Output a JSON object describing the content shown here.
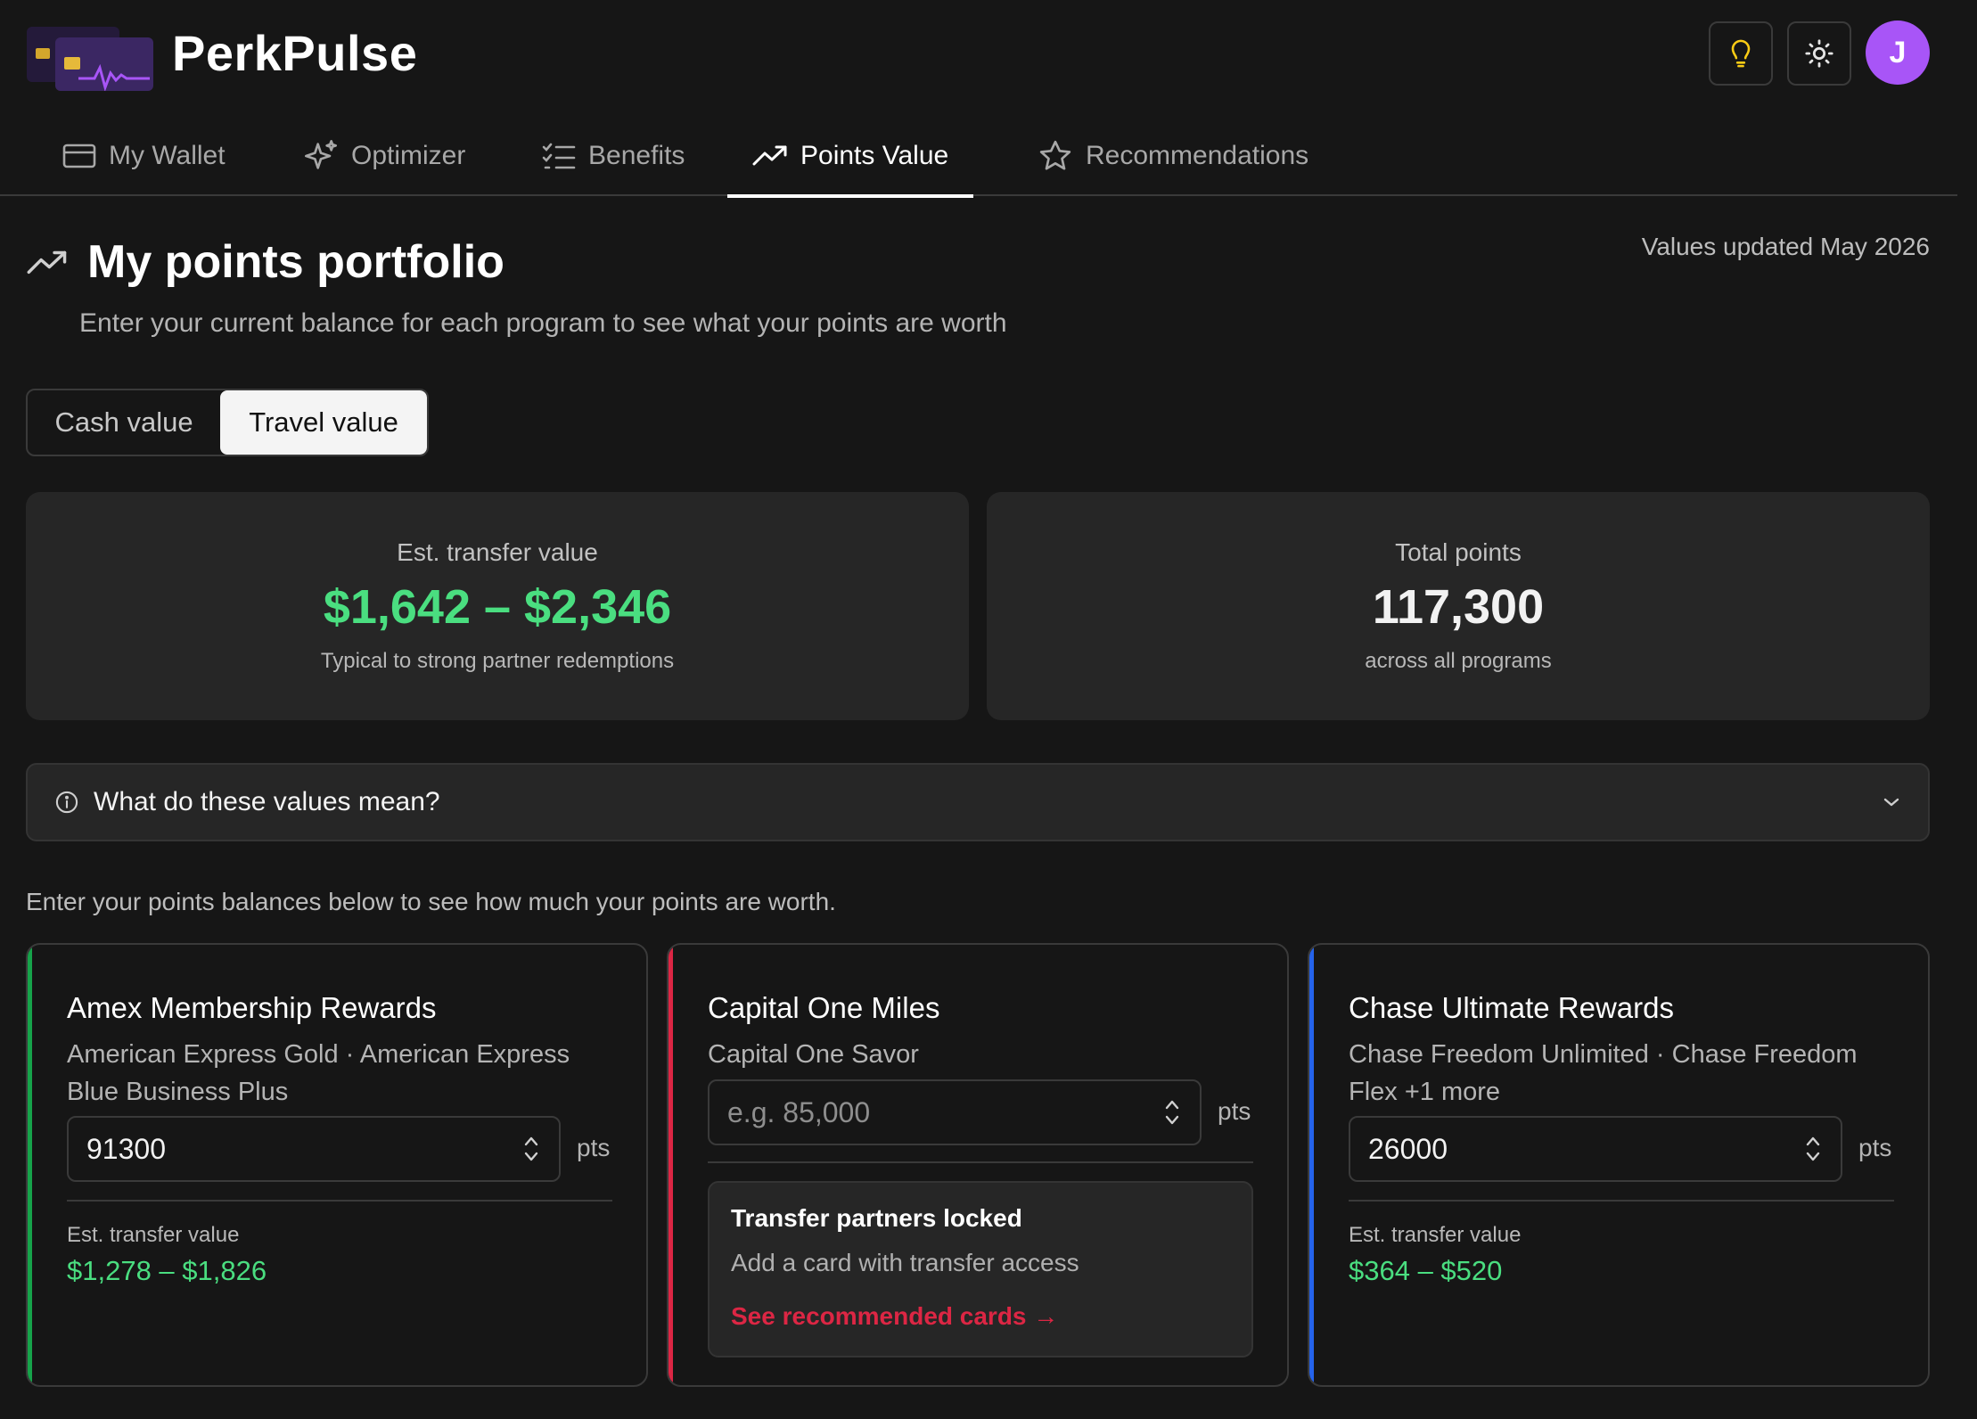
{
  "app": {
    "brand": "PerkPulse",
    "avatar_initial": "J",
    "accent_purple": "#a855f7"
  },
  "tabs": [
    {
      "label": "My Wallet",
      "icon": "wallet-icon",
      "active": false
    },
    {
      "label": "Optimizer",
      "icon": "sparkles-icon",
      "active": false
    },
    {
      "label": "Benefits",
      "icon": "checklist-icon",
      "active": false
    },
    {
      "label": "Points Value",
      "icon": "trending-up-icon",
      "active": true
    },
    {
      "label": "Recommendations",
      "icon": "star-icon",
      "active": false
    }
  ],
  "page": {
    "title": "My points portfolio",
    "updated": "Values updated May 2026",
    "subtitle": "Enter your current balance for each program to see what your points are worth"
  },
  "toggle": {
    "cash": "Cash value",
    "travel": "Travel value",
    "selected": "Travel value"
  },
  "stats": {
    "transfer": {
      "label": "Est. transfer value",
      "value": "$1,642 – $2,346",
      "note": "Typical to strong partner redemptions"
    },
    "total": {
      "label": "Total points",
      "value": "117,300",
      "note": "across all programs"
    }
  },
  "accordion": {
    "question": "What do these values mean?"
  },
  "hint": "Enter your points balances below to see how much your points are worth.",
  "programs": [
    {
      "title": "Amex Membership Rewards",
      "cards": "American Express Gold · American Express Blue Business Plus",
      "balance": "91300",
      "unit": "pts",
      "est_label": "Est. transfer value",
      "est_value": "$1,278 – $1,826",
      "accent": "#16a34a"
    },
    {
      "title": "Capital One Miles",
      "cards": "Capital One Savor",
      "placeholder": "e.g. 85,000",
      "unit": "pts",
      "locked_title": "Transfer partners locked",
      "locked_sub": "Add a card with transfer access",
      "locked_link": "See recommended cards →",
      "accent": "#dc2644"
    },
    {
      "title": "Chase Ultimate Rewards",
      "cards": "Chase Freedom Unlimited · Chase Freedom Flex +1 more",
      "balance": "26000",
      "unit": "pts",
      "est_label": "Est. transfer value",
      "est_value": "$364 – $520",
      "accent": "#2563eb"
    }
  ],
  "colors": {
    "background": "#161616",
    "card": "#262626",
    "positive": "#4ade80",
    "danger": "#dc2644"
  }
}
